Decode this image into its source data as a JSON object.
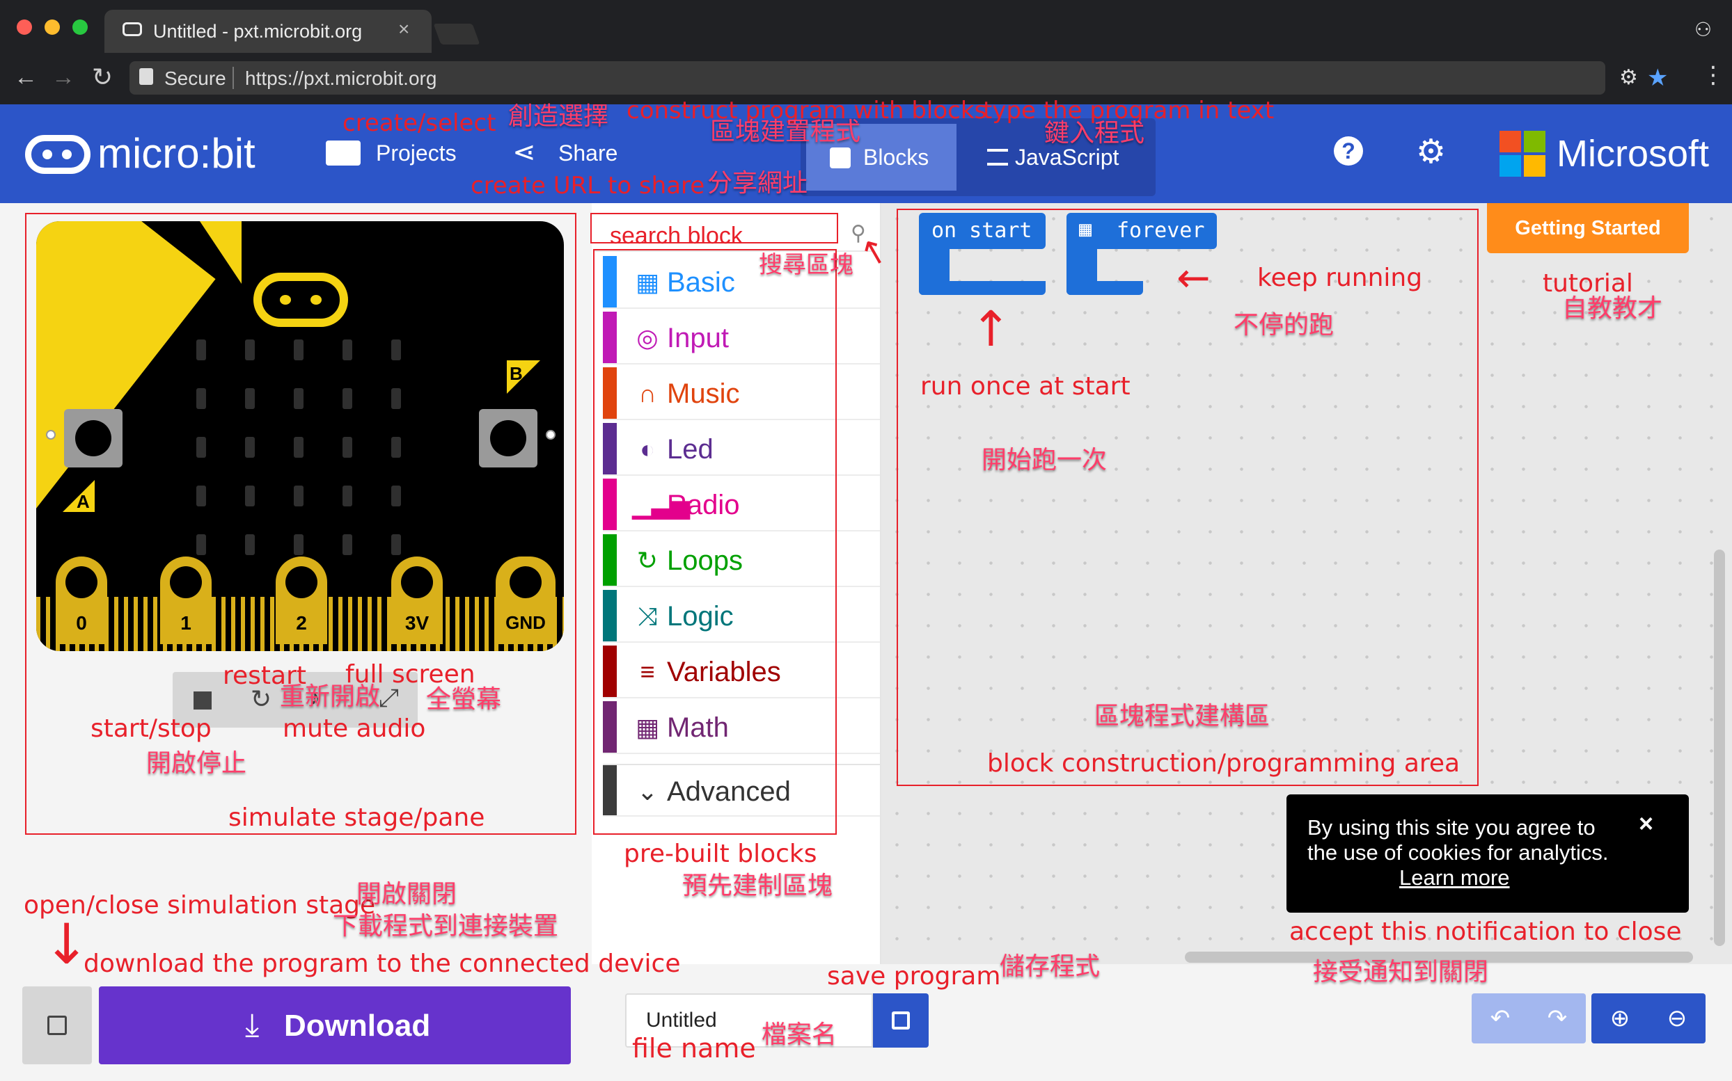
{
  "browser": {
    "tab_title": "Untitled - pxt.microbit.org",
    "secure_label": "Secure",
    "url": "https://pxt.microbit.org"
  },
  "header": {
    "logo_text": "micro:bit",
    "projects_label": "Projects",
    "share_label": "Share",
    "blocks_label": "Blocks",
    "javascript_label": "JavaScript",
    "microsoft_label": "Microsoft"
  },
  "simulator": {
    "pins": [
      "0",
      "1",
      "2",
      "3V",
      "GND"
    ],
    "button_a": "A",
    "button_b": "B"
  },
  "toolbox": {
    "search_placeholder": "search block",
    "categories": [
      {
        "label": "Basic",
        "color": "#1e90ff",
        "icon": "grid-icon"
      },
      {
        "label": "Input",
        "color": "#c01ab5",
        "icon": "target-icon"
      },
      {
        "label": "Music",
        "color": "#e0440e",
        "icon": "headphones-icon"
      },
      {
        "label": "Led",
        "color": "#5c2d91",
        "icon": "toggle-icon"
      },
      {
        "label": "Radio",
        "color": "#e3008c",
        "icon": "signal-icon"
      },
      {
        "label": "Loops",
        "color": "#00a000",
        "icon": "loop-icon"
      },
      {
        "label": "Logic",
        "color": "#00767a",
        "icon": "shuffle-icon"
      },
      {
        "label": "Variables",
        "color": "#a00000",
        "icon": "lines-icon"
      },
      {
        "label": "Math",
        "color": "#712672",
        "icon": "calculator-icon"
      }
    ],
    "advanced_label": "Advanced"
  },
  "workspace": {
    "on_start_label": "on start",
    "forever_label": "forever",
    "getting_started_label": "Getting Started"
  },
  "cookie": {
    "text": "By using this site you agree to the use of cookies for analytics.",
    "learn_more": "Learn more"
  },
  "footer": {
    "download_label": "Download",
    "filename": "Untitled"
  },
  "annotations": {
    "create_select": "create/select",
    "chuang_zao": "創造選擇",
    "construct": "construct program with blocks",
    "qu_kuai_jian_zhi": "區塊建置程式",
    "type_program": "type the program in text",
    "jian_ru": "鍵入程式",
    "create_url": "create URL to share",
    "fen_xiang": "分享網址",
    "search_block": "search block",
    "sou_xun": "搜尋區塊",
    "run_once": "run once at start",
    "kai_shi": "開始跑一次",
    "keep_running": "keep running",
    "bu_ting": "不停的跑",
    "tutorial": "tutorial",
    "zi_jiao": "自教教才",
    "restart": "restart",
    "full_screen": "full screen",
    "chong_xin": "重新開啟",
    "quan_ying": "全螢幕",
    "start_stop": "start/stop",
    "mute_audio": "mute audio",
    "kai_qi_ting": "開啟停止",
    "simulate_stage": "simulate stage/pane",
    "qu_kuai_jian_gou": "區塊程式建構區",
    "block_construction": "block construction/programming area",
    "pre_built": "pre-built blocks",
    "yu_xian": "預先建制區塊",
    "open_close": "open/close simulation stage",
    "kai_qi_guan_bi": "開啟關閉",
    "xia_zai": "下載程式到連接裝置",
    "download_program": "download the program to the connected device",
    "save_program": "save program",
    "chu_cun": "儲存程式",
    "accept_notification": "accept this notification to close",
    "jie_shou": "接受通知到關閉",
    "file_name": "file name",
    "dang_an": "檔案名"
  }
}
